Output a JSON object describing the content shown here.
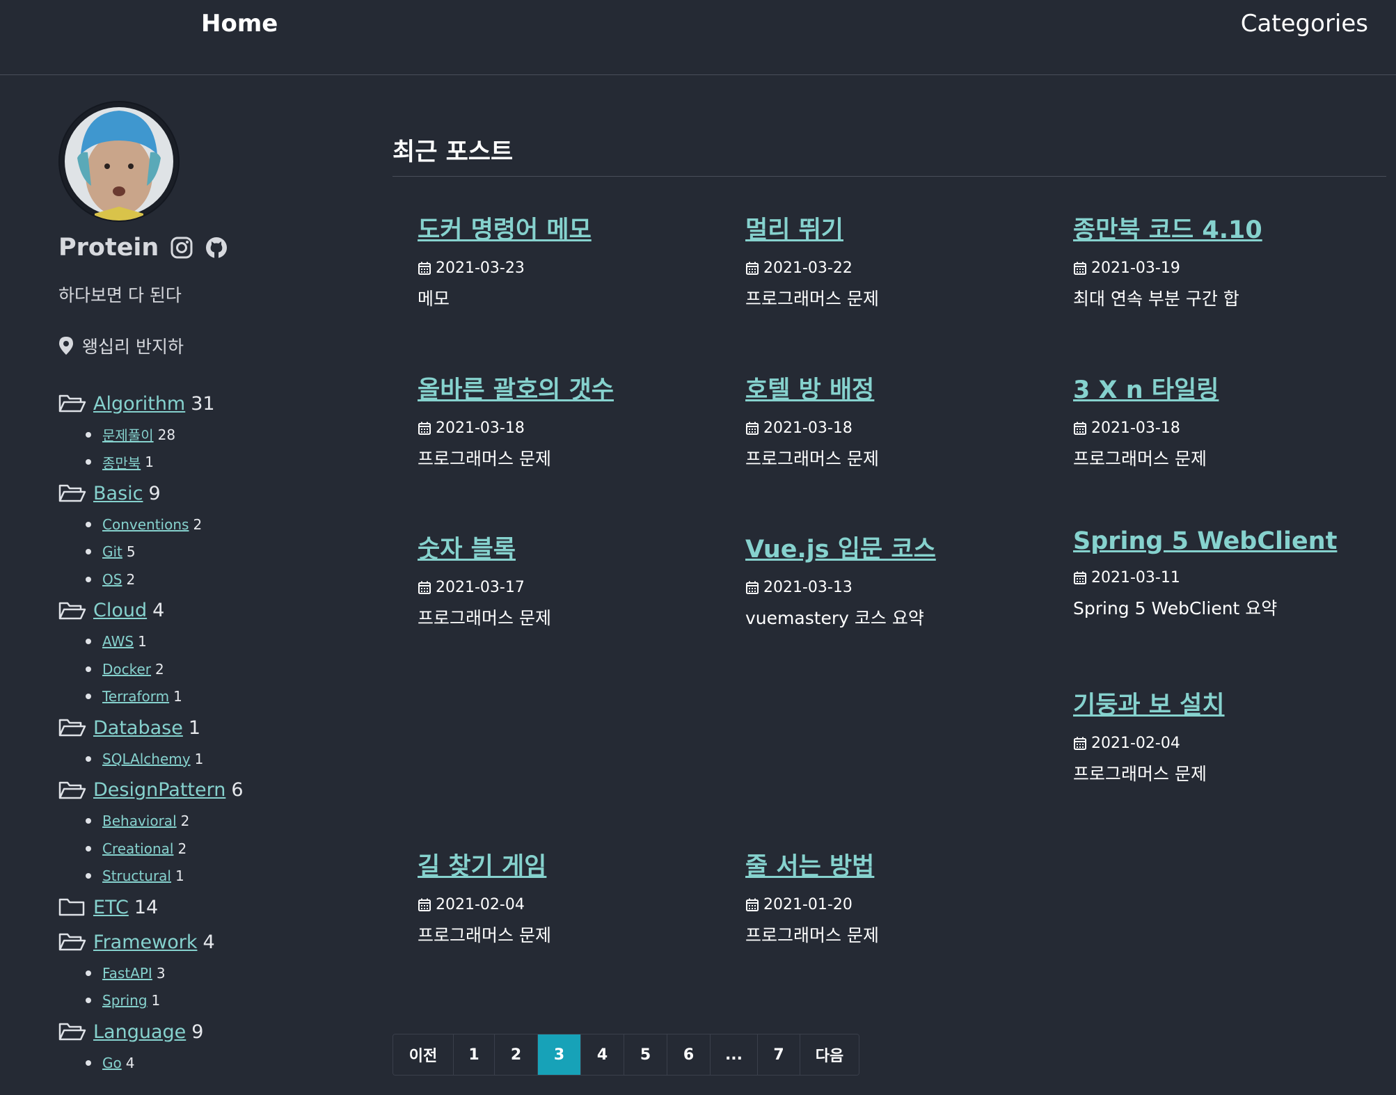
{
  "nav": {
    "home": "Home",
    "categories": "Categories"
  },
  "profile": {
    "name": "Protein",
    "bio": "하다보면 다 된다",
    "location": "왱십리 반지하"
  },
  "categories": [
    {
      "name": "Algorithm",
      "count": "31",
      "icon": "folder-open-icon",
      "subs": [
        {
          "name": "문제풀이",
          "count": "28"
        },
        {
          "name": "종만북",
          "count": "1"
        }
      ]
    },
    {
      "name": "Basic",
      "count": "9",
      "icon": "folder-open-icon",
      "subs": [
        {
          "name": "Conventions",
          "count": "2"
        },
        {
          "name": "Git",
          "count": "5"
        },
        {
          "name": "OS",
          "count": "2"
        }
      ]
    },
    {
      "name": "Cloud",
      "count": "4",
      "icon": "folder-open-icon",
      "subs": [
        {
          "name": "AWS",
          "count": "1"
        },
        {
          "name": "Docker",
          "count": "2"
        },
        {
          "name": "Terraform",
          "count": "1"
        }
      ]
    },
    {
      "name": "Database",
      "count": "1",
      "icon": "folder-open-icon",
      "subs": [
        {
          "name": "SQLAlchemy",
          "count": "1"
        }
      ]
    },
    {
      "name": "DesignPattern",
      "count": "6",
      "icon": "folder-open-icon",
      "subs": [
        {
          "name": "Behavioral",
          "count": "2"
        },
        {
          "name": "Creational",
          "count": "2"
        },
        {
          "name": "Structural",
          "count": "1"
        }
      ]
    },
    {
      "name": "ETC",
      "count": "14",
      "icon": "folder-icon",
      "subs": []
    },
    {
      "name": "Framework",
      "count": "4",
      "icon": "folder-open-icon",
      "subs": [
        {
          "name": "FastAPI",
          "count": "3"
        },
        {
          "name": "Spring",
          "count": "1"
        }
      ]
    },
    {
      "name": "Language",
      "count": "9",
      "icon": "folder-open-icon",
      "subs": [
        {
          "name": "Go",
          "count": "4"
        }
      ]
    }
  ],
  "main": {
    "title": "최근 포스트"
  },
  "posts": [
    {
      "title": "도커 명령어 메모",
      "date": "2021-03-23",
      "desc": "메모"
    },
    {
      "title": "멀리 뛰기",
      "date": "2021-03-22",
      "desc": "프로그래머스 문제"
    },
    {
      "title": "종만북 코드 4.10",
      "date": "2021-03-19",
      "desc": "최대 연속 부분 구간 합"
    },
    {
      "title": "올바른 괄호의 갯수",
      "date": "2021-03-18",
      "desc": "프로그래머스 문제"
    },
    {
      "title": "호텔 방 배정",
      "date": "2021-03-18",
      "desc": "프로그래머스 문제"
    },
    {
      "title": "3 X n 타일링",
      "date": "2021-03-18",
      "desc": "프로그래머스 문제"
    },
    {
      "title": "숫자 블록",
      "date": "2021-03-17",
      "desc": "프로그래머스 문제"
    },
    {
      "title": "Vue.js 입문 코스",
      "date": "2021-03-13",
      "desc": "vuemastery 코스 요약"
    },
    {
      "title": "Spring 5 WebClient",
      "date": "2021-03-11",
      "desc": "Spring 5 WebClient 요약"
    },
    {
      "title": "기둥과 보 설치",
      "date": "2021-02-04",
      "desc": "프로그래머스 문제"
    },
    {
      "title": "길 찾기 게임",
      "date": "2021-02-04",
      "desc": "프로그래머스 문제"
    },
    {
      "title": "줄 서는 방법",
      "date": "2021-01-20",
      "desc": "프로그래머스 문제"
    }
  ],
  "pagination": {
    "items": [
      "이전",
      "1",
      "2",
      "3",
      "4",
      "5",
      "6",
      "...",
      "7",
      "다음"
    ],
    "active": "3"
  },
  "colors": {
    "background": "#252a34",
    "link": "#86d2ce",
    "active_page": "#17a2b8"
  }
}
